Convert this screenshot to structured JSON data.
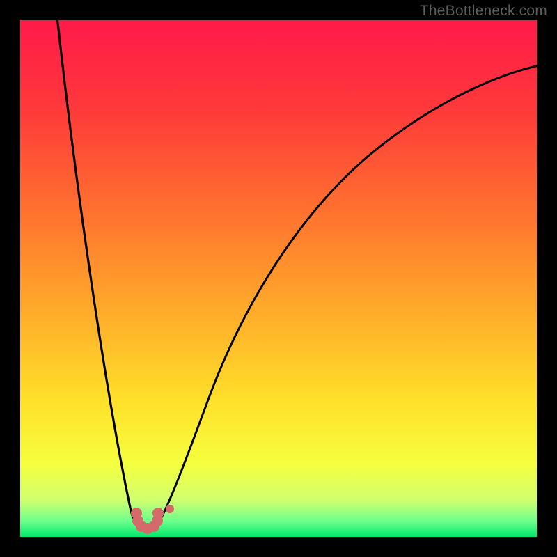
{
  "watermark": "TheBottleneck.com",
  "chart_data": {
    "type": "line",
    "title": "",
    "xlabel": "",
    "ylabel": "",
    "xlim": [
      0,
      100
    ],
    "ylim": [
      0,
      100
    ],
    "background_gradient": {
      "orientation": "vertical",
      "stops": [
        {
          "pos": 0.0,
          "color": "#ff1a4a"
        },
        {
          "pos": 0.18,
          "color": "#ff3b3a"
        },
        {
          "pos": 0.4,
          "color": "#ff7a2e"
        },
        {
          "pos": 0.58,
          "color": "#ffb02a"
        },
        {
          "pos": 0.74,
          "color": "#ffe12a"
        },
        {
          "pos": 0.86,
          "color": "#f5ff3e"
        },
        {
          "pos": 0.93,
          "color": "#d0ff70"
        },
        {
          "pos": 0.97,
          "color": "#6bff8c"
        },
        {
          "pos": 1.0,
          "color": "#00e86a"
        }
      ]
    },
    "series": [
      {
        "name": "left_branch",
        "x": [
          7,
          9,
          11,
          13,
          15,
          17,
          19,
          21,
          22.6
        ],
        "y": [
          100,
          86,
          72,
          58,
          44,
          31,
          18,
          8,
          2.5
        ]
      },
      {
        "name": "valley",
        "x": [
          22.6,
          23.5,
          24.6,
          25.6,
          26.7
        ],
        "y": [
          2.5,
          1.5,
          1.3,
          1.5,
          2.5
        ]
      },
      {
        "name": "right_branch",
        "x": [
          26.7,
          30,
          36,
          44,
          54,
          66,
          80,
          95,
          100
        ],
        "y": [
          2.5,
          10,
          26,
          44,
          60,
          72,
          82,
          89,
          91
        ]
      }
    ],
    "markers": {
      "valley_cluster": {
        "color": "#d46a6a",
        "points": [
          {
            "x": 22.5,
            "y": 4.6
          },
          {
            "x": 22.8,
            "y": 3.1
          },
          {
            "x": 23.5,
            "y": 2.0
          },
          {
            "x": 24.7,
            "y": 1.6
          },
          {
            "x": 25.9,
            "y": 2.0
          },
          {
            "x": 26.5,
            "y": 3.1
          },
          {
            "x": 26.7,
            "y": 4.6
          }
        ]
      },
      "outlier": {
        "color": "#d46a6a",
        "x": 29.0,
        "y": 5.4
      }
    }
  }
}
